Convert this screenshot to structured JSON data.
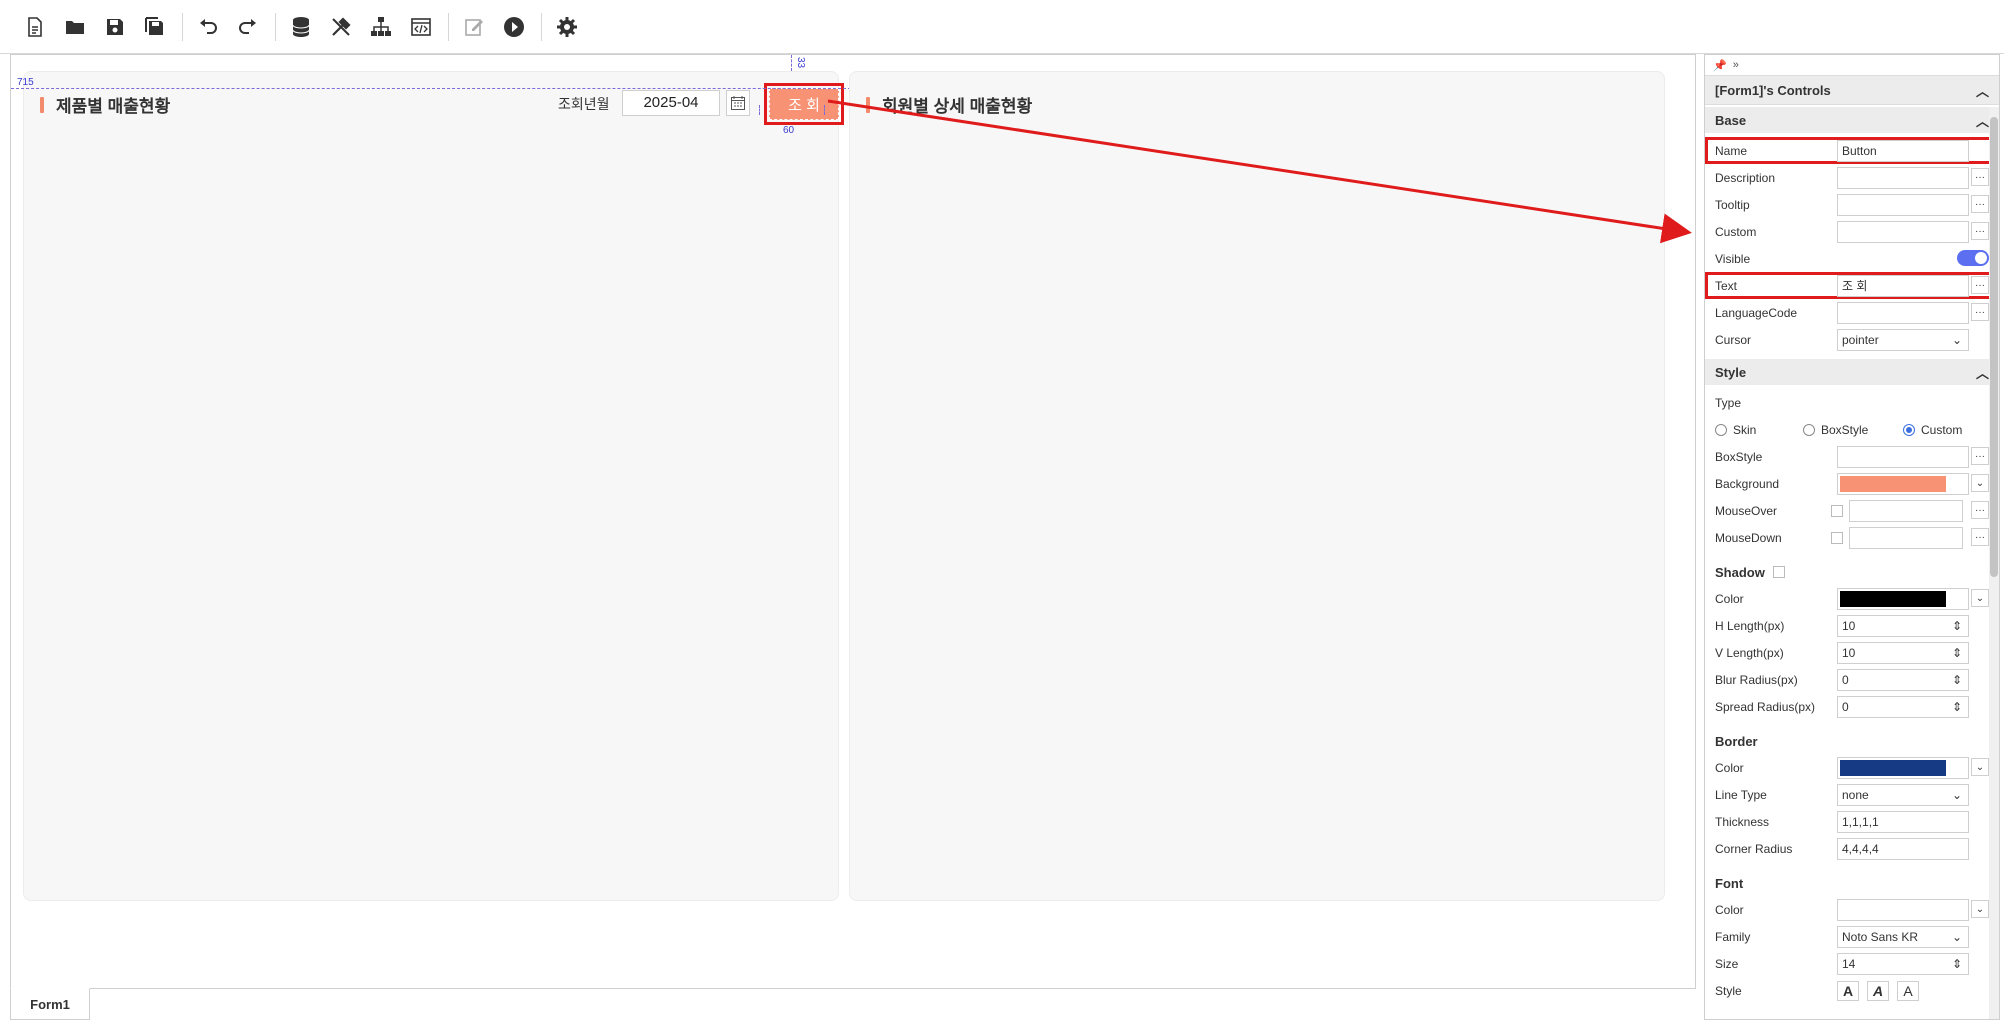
{
  "toolbar": {
    "icons": [
      "new-file-icon",
      "open-folder-icon",
      "save-icon",
      "save-all-icon",
      "undo-icon",
      "redo-icon",
      "database-icon",
      "tools-icon",
      "tree-icon",
      "code-window-icon",
      "edit-icon",
      "play-icon",
      "gear-icon"
    ]
  },
  "left_panel": {
    "title": "제품별 매출현황",
    "cond_label": "조회년월",
    "month_value": "2025-04",
    "search_button": "조 회",
    "guide_left": "715",
    "guide_top": "33",
    "guide_width": "60"
  },
  "right_panel": {
    "title": "회원별 상세 매출현황"
  },
  "form_tab": "Form1",
  "props": {
    "header": "[Form1]'s Controls",
    "base": {
      "title": "Base",
      "name_label": "Name",
      "name_value": "Button",
      "desc_label": "Description",
      "tooltip_label": "Tooltip",
      "custom_label": "Custom",
      "visible_label": "Visible",
      "text_label": "Text",
      "text_value": "조 회",
      "lang_label": "LanguageCode",
      "cursor_label": "Cursor",
      "cursor_value": "pointer"
    },
    "style": {
      "title": "Style",
      "type_label": "Type",
      "type_skin": "Skin",
      "type_boxstyle": "BoxStyle",
      "type_custom": "Custom",
      "boxstyle_label": "BoxStyle",
      "background_label": "Background",
      "mouseover_label": "MouseOver",
      "mousedown_label": "MouseDown",
      "background_color": "#f79374"
    },
    "shadow": {
      "title": "Shadow",
      "color_label": "Color",
      "hlen_label": "H Length(px)",
      "hlen": "10",
      "vlen_label": "V Length(px)",
      "vlen": "10",
      "blur_label": "Blur Radius(px)",
      "blur": "0",
      "spread_label": "Spread Radius(px)",
      "spread": "0"
    },
    "border": {
      "title": "Border",
      "color_label": "Color",
      "linetype_label": "Line Type",
      "linetype": "none",
      "thickness_label": "Thickness",
      "thickness": "1,1,1,1",
      "radius_label": "Corner Radius",
      "radius": "4,4,4,4",
      "color": "#163a84"
    },
    "font": {
      "title": "Font",
      "color_label": "Color",
      "family_label": "Family",
      "family": "Noto Sans KR",
      "size_label": "Size",
      "size": "14",
      "style_label": "Style"
    }
  }
}
